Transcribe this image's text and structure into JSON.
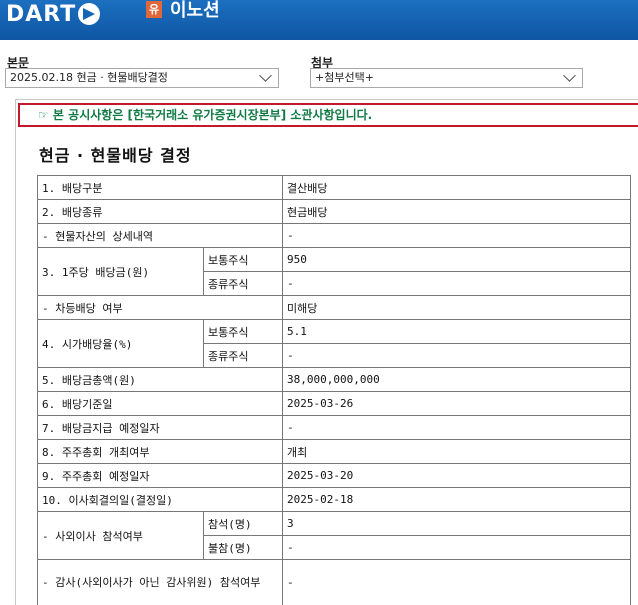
{
  "header": {
    "logo_text": "DART",
    "company_badge": "유",
    "company_name": "이노션"
  },
  "body_select": {
    "label": "본문",
    "value": "2025.02.18 현금 · 현물배당결정"
  },
  "attach_select": {
    "label": "첨부",
    "value": "+첨부선택+"
  },
  "notice": "☞ 본 공시사항은 [한국거래소 유가증권시장본부] 소관사항입니다.",
  "doc_title": "현금 · 현물배당 결정",
  "rows": {
    "r1": {
      "label": "1. 배당구분",
      "value": "결산배당"
    },
    "r2": {
      "label": "2. 배당종류",
      "value": "현금배당"
    },
    "r3": {
      "label": "- 현물자산의 상세내역",
      "value": "-"
    },
    "r4": {
      "label": "3. 1주당 배당금(원)",
      "sub1": "보통주식",
      "val1": "950",
      "sub2": "종류주식",
      "val2": "-"
    },
    "r5": {
      "label": "- 차등배당 여부",
      "value": "미해당"
    },
    "r6": {
      "label": "4. 시가배당율(%)",
      "sub1": "보통주식",
      "val1": "5.1",
      "sub2": "종류주식",
      "val2": "-"
    },
    "r7": {
      "label": "5. 배당금총액(원)",
      "value": "38,000,000,000"
    },
    "r8": {
      "label": "6. 배당기준일",
      "value": "2025-03-26"
    },
    "r9": {
      "label": "7. 배당금지급 예정일자",
      "value": "-"
    },
    "r10": {
      "label": "8. 주주총회 개최여부",
      "value": "개최"
    },
    "r11": {
      "label": "9. 주주총회 예정일자",
      "value": "2025-03-20"
    },
    "r12": {
      "label": "10. 이사회결의일(결정일)",
      "value": "2025-02-18"
    },
    "r13": {
      "label": "- 사외이사 참석여부",
      "sub1": "참석(명)",
      "val1": "3",
      "sub2": "불참(명)",
      "val2": "-"
    },
    "r14": {
      "label": "- 감사(사외이사가 아닌 감사위원) 참석여부",
      "value": "-"
    }
  }
}
